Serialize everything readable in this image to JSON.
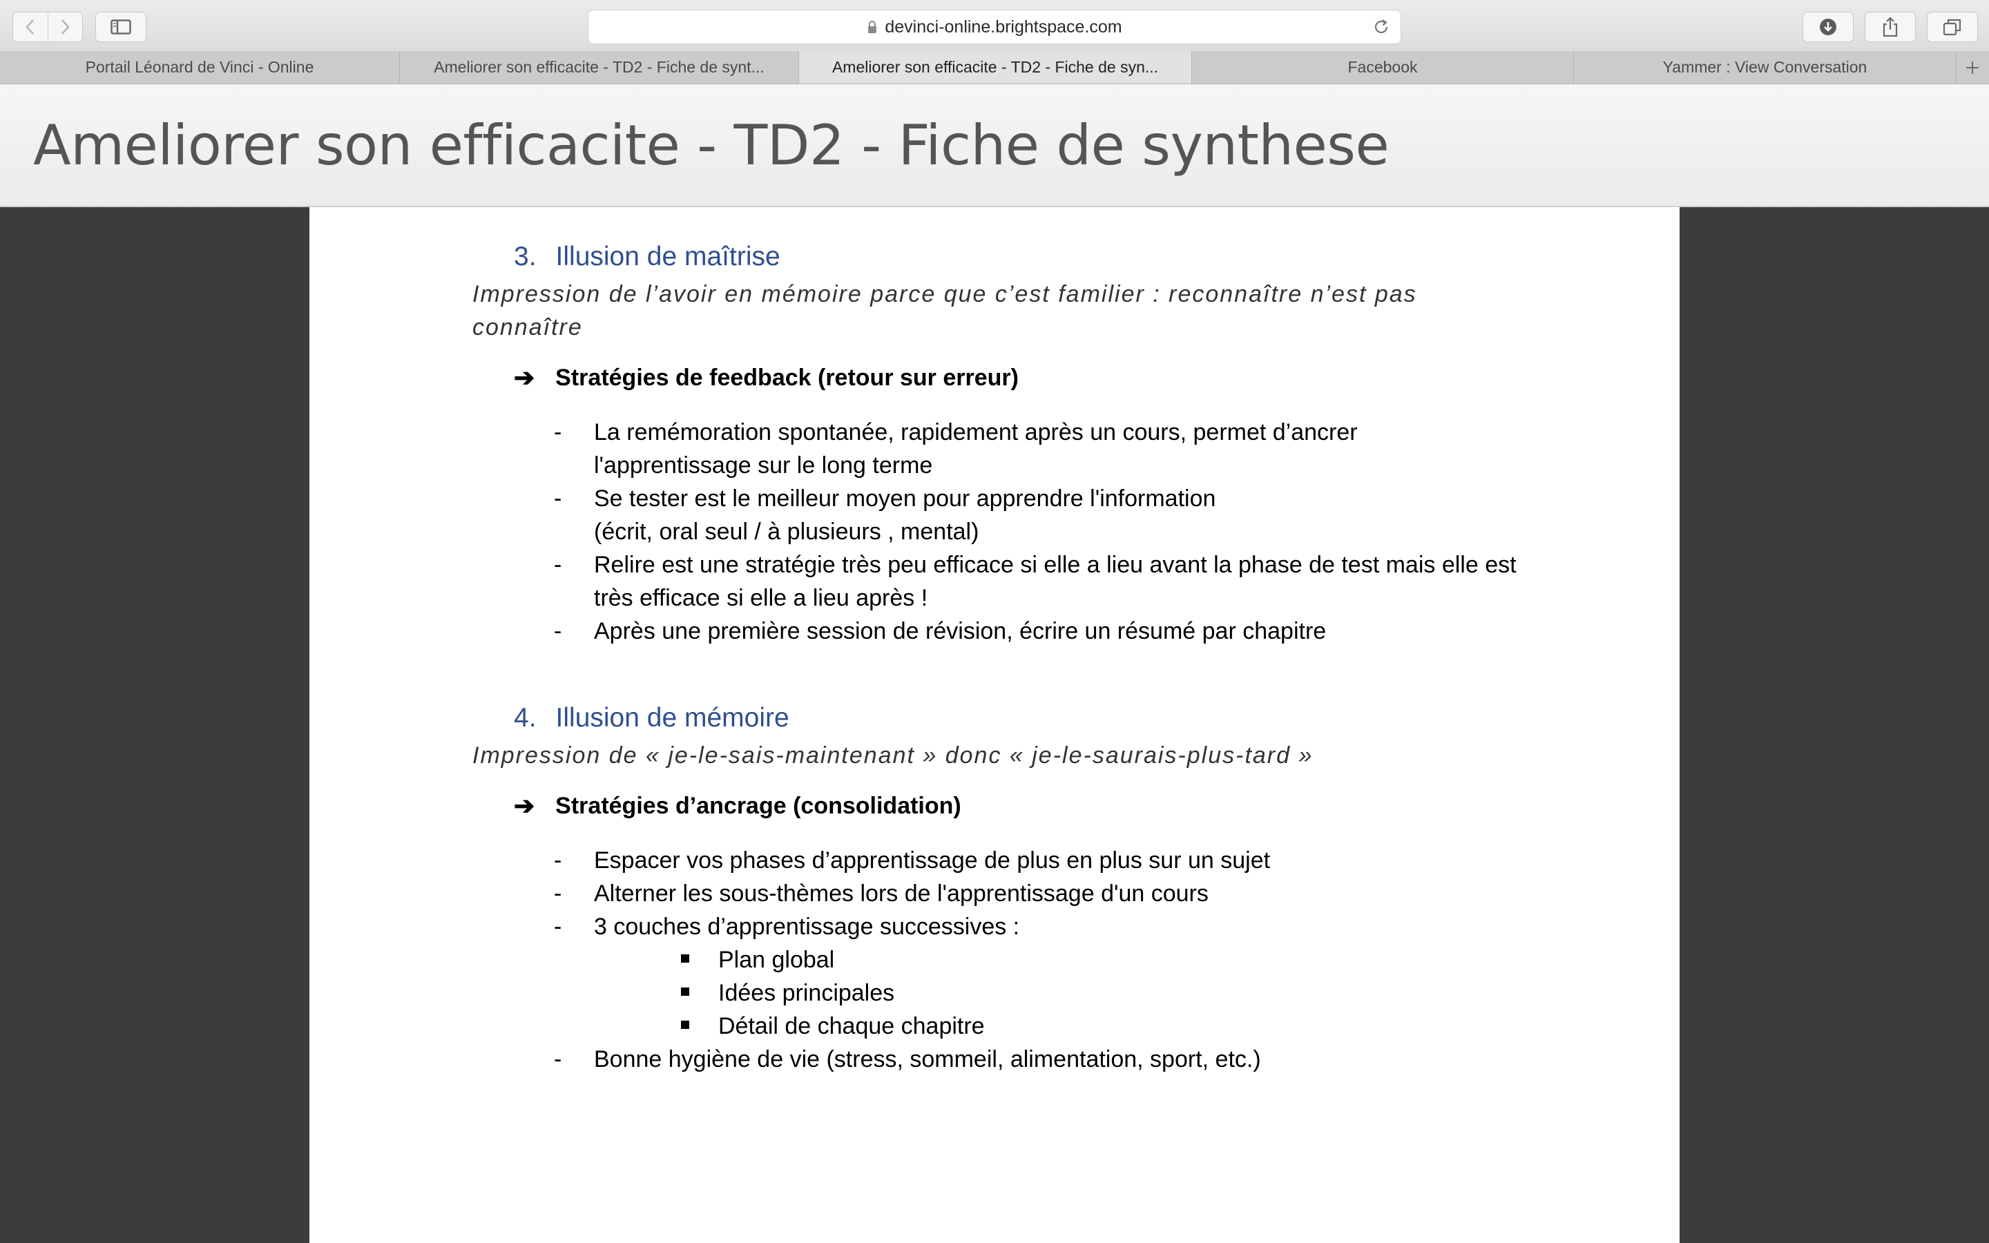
{
  "browser": {
    "url": "devinci-online.brightspace.com",
    "tabs": [
      {
        "label": "Portail Léonard de Vinci - Online"
      },
      {
        "label": "Ameliorer son efficacite - TD2 - Fiche de synt..."
      },
      {
        "label": "Ameliorer son efficacite - TD2 - Fiche de syn..."
      },
      {
        "label": "Facebook"
      },
      {
        "label": "Yammer : View Conversation"
      }
    ],
    "icons": {
      "back": "chevron-left-icon",
      "forward": "chevron-right-icon",
      "sidebar": "sidebar-icon",
      "lock": "lock-icon",
      "reload": "reload-icon",
      "downloads": "download-icon",
      "share": "share-icon",
      "tab_overview": "tabs-overview-icon",
      "new_tab": "plus-icon"
    }
  },
  "page": {
    "title": "Ameliorer son efficacite - TD2 - Fiche de synthese"
  },
  "document": {
    "section3": {
      "number": "3.",
      "heading": "Illusion de maîtrise",
      "subtitle_line1": "Impression de l’avoir en mémoire parce que c’est familier : reconnaître n’est pas",
      "subtitle_line2": "connaître",
      "strategy": "Stratégies de feedback (retour sur erreur)",
      "bullets": [
        {
          "line1": "La remémoration spontanée, rapidement après un cours, permet d’ancrer",
          "line2": "l'apprentissage sur le long terme"
        },
        {
          "line1": "Se tester est le meilleur moyen pour apprendre l'information",
          "line2": "(écrit, oral seul / à plusieurs , mental)"
        },
        {
          "line1": "Relire est une stratégie très peu efficace si elle a lieu avant la phase de test mais elle est",
          "line2": "très efficace si elle a lieu après !"
        },
        {
          "line1": "Après une première session de révision, écrire un résumé par chapitre"
        }
      ]
    },
    "section4": {
      "number": "4.",
      "heading": "Illusion de mémoire",
      "subtitle": "Impression de « je-le-sais-maintenant » donc « je-le-saurais-plus-tard »",
      "strategy": "Stratégies d’ancrage (consolidation)",
      "bullets": [
        {
          "line1": "Espacer vos phases d’apprentissage de plus en plus sur un sujet"
        },
        {
          "line1": "Alterner les sous-thèmes lors de l'apprentissage d'un cours"
        },
        {
          "line1": "3 couches d’apprentissage successives :"
        }
      ],
      "sub_bullets": [
        "Plan global",
        "Idées principales",
        "Détail de chaque chapitre"
      ],
      "last_bullet": "Bonne hygiène de vie (stress, sommeil, alimentation, sport, etc.)"
    },
    "bullet_dash": "-",
    "arrow": "➔"
  }
}
